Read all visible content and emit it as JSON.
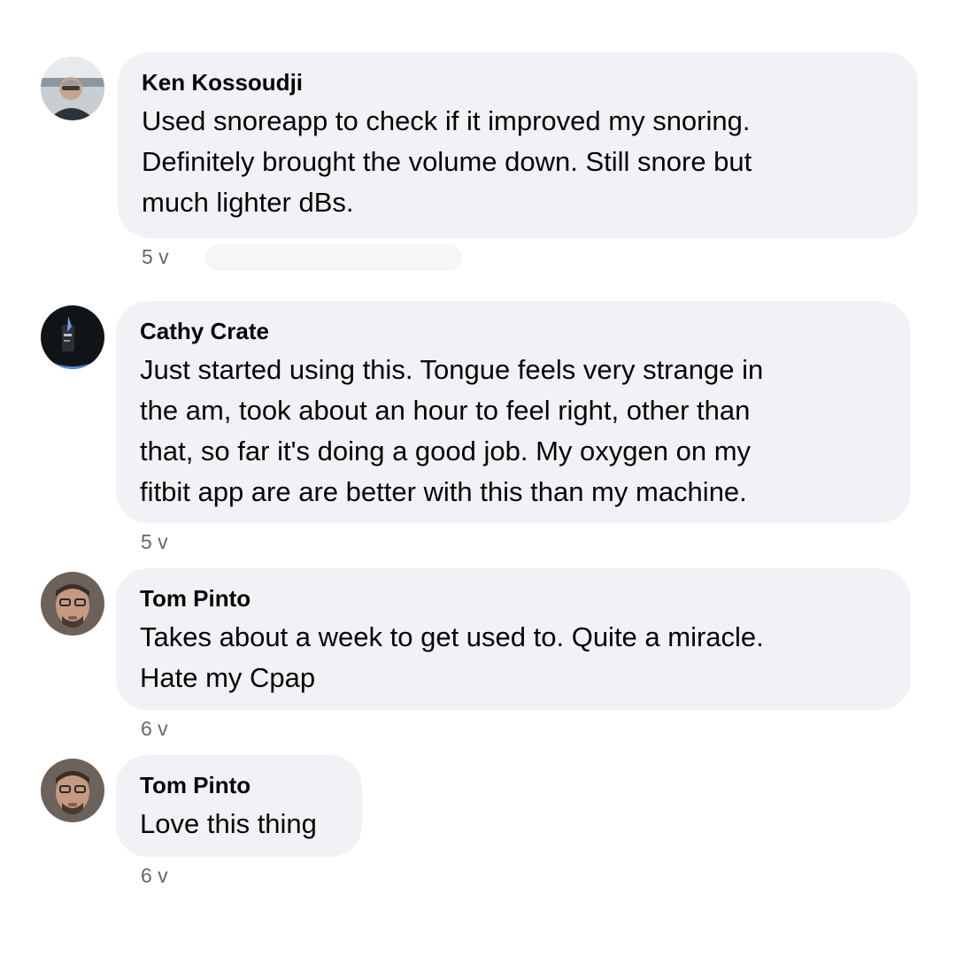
{
  "comments": [
    {
      "author": "Ken Kossoudji",
      "text": "Used snoreapp to check if it improved my snoring.\nDefinitely brought the volume down. Still snore but\nmuch lighter dBs.",
      "time": "5 v"
    },
    {
      "author": "Cathy Crate",
      "text": "Just started using this. Tongue feels very strange in\nthe am, took about an hour to feel right, other than\nthat, so far it's doing a good job. My oxygen on my\nfitbit app are are better with this than my machine.",
      "time": "5 v"
    },
    {
      "author": "Tom Pinto",
      "text": "Takes about a week to get used to. Quite a miracle.\nHate my Cpap",
      "time": "6 v"
    },
    {
      "author": "Tom Pinto",
      "text": "Love this thing",
      "time": "6 v"
    }
  ],
  "colors": {
    "bubble": "#f0f2f5",
    "meta_text": "#65676b",
    "text": "#050505"
  }
}
